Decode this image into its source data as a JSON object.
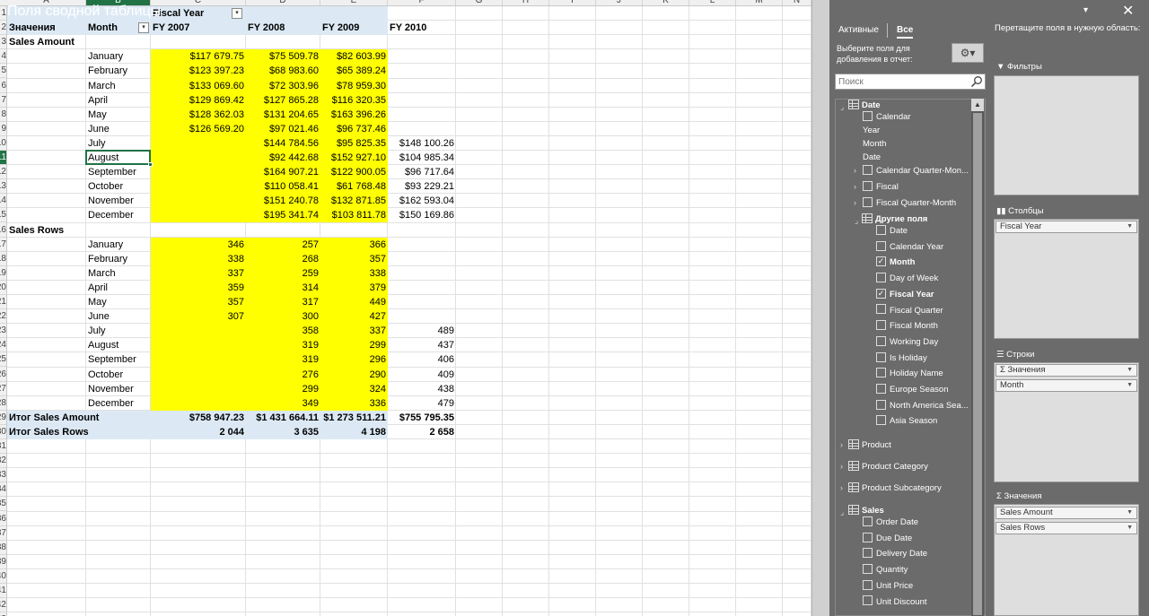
{
  "sheet": {
    "columns": [
      "A",
      "B",
      "C",
      "D",
      "E",
      "F",
      "G",
      "H",
      "I",
      "J",
      "K",
      "L",
      "M",
      "N"
    ],
    "pivot_header": {
      "fiscal_year_label": "Fiscal Year",
      "values_label": "Значения",
      "month_label": "Month",
      "years": [
        "FY 2007",
        "FY 2008",
        "FY 2009",
        "FY 2010"
      ]
    },
    "sales_amount": {
      "label": "Sales Amount",
      "rows": [
        {
          "month": "January",
          "vals": [
            "$117 679.75",
            "$75 509.78",
            "$82 603.99",
            ""
          ]
        },
        {
          "month": "February",
          "vals": [
            "$123 397.23",
            "$68 983.60",
            "$65 389.24",
            ""
          ]
        },
        {
          "month": "March",
          "vals": [
            "$133 069.60",
            "$72 303.96",
            "$78 959.30",
            ""
          ]
        },
        {
          "month": "April",
          "vals": [
            "$129 869.42",
            "$127 865.28",
            "$116 320.35",
            ""
          ]
        },
        {
          "month": "May",
          "vals": [
            "$128 362.03",
            "$131 204.65",
            "$163 396.26",
            ""
          ]
        },
        {
          "month": "June",
          "vals": [
            "$126 569.20",
            "$97 021.46",
            "$96 737.46",
            ""
          ]
        },
        {
          "month": "July",
          "vals": [
            "",
            "$144 784.56",
            "$95 825.35",
            "$148 100.26"
          ]
        },
        {
          "month": "August",
          "vals": [
            "",
            "$92 442.68",
            "$152 927.10",
            "$104 985.34"
          ]
        },
        {
          "month": "September",
          "vals": [
            "",
            "$164 907.21",
            "$122 900.05",
            "$96 717.64"
          ]
        },
        {
          "month": "October",
          "vals": [
            "",
            "$110 058.41",
            "$61 768.48",
            "$93 229.21"
          ]
        },
        {
          "month": "November",
          "vals": [
            "",
            "$151 240.78",
            "$132 871.85",
            "$162 593.04"
          ]
        },
        {
          "month": "December",
          "vals": [
            "",
            "$195 341.74",
            "$103 811.78",
            "$150 169.86"
          ]
        }
      ]
    },
    "sales_rows": {
      "label": "Sales Rows",
      "rows": [
        {
          "month": "January",
          "vals": [
            "346",
            "257",
            "366",
            ""
          ]
        },
        {
          "month": "February",
          "vals": [
            "338",
            "268",
            "357",
            ""
          ]
        },
        {
          "month": "March",
          "vals": [
            "337",
            "259",
            "338",
            ""
          ]
        },
        {
          "month": "April",
          "vals": [
            "359",
            "314",
            "379",
            ""
          ]
        },
        {
          "month": "May",
          "vals": [
            "357",
            "317",
            "449",
            ""
          ]
        },
        {
          "month": "June",
          "vals": [
            "307",
            "300",
            "427",
            ""
          ]
        },
        {
          "month": "July",
          "vals": [
            "",
            "358",
            "337",
            "489"
          ]
        },
        {
          "month": "August",
          "vals": [
            "",
            "319",
            "299",
            "437"
          ]
        },
        {
          "month": "September",
          "vals": [
            "",
            "319",
            "296",
            "406"
          ]
        },
        {
          "month": "October",
          "vals": [
            "",
            "276",
            "290",
            "409"
          ]
        },
        {
          "month": "November",
          "vals": [
            "",
            "299",
            "324",
            "438"
          ]
        },
        {
          "month": "December",
          "vals": [
            "",
            "349",
            "336",
            "479"
          ]
        }
      ]
    },
    "totals": [
      {
        "label": "Итог Sales Amount",
        "vals": [
          "$758 947.23",
          "$1 431 664.11",
          "$1 273 511.21",
          "$755 795.35"
        ]
      },
      {
        "label": "Итог Sales Rows",
        "vals": [
          "2 044",
          "3 635",
          "4 198",
          "2 658"
        ]
      }
    ],
    "highlight_color": "#ffff00",
    "header_band_color": "#dce9f5",
    "active_cell": "August"
  },
  "pivot_panel": {
    "title": "Поля сводной таблицы",
    "tabs": {
      "active": "Активные",
      "all": "Все"
    },
    "choose_fields": "Выберите поля для добавления в отчет:",
    "search_placeholder": "Поиск",
    "drag_hint": "Перетащите поля в нужную область:",
    "fields": {
      "date_table": "Date",
      "date_items": [
        "Calendar",
        "Year",
        "Month",
        "Date",
        "Calendar Quarter-Mon...",
        "Fiscal",
        "Fiscal Quarter-Month"
      ],
      "other_fields": "Другие поля",
      "other_items": [
        {
          "label": "Date",
          "checked": false
        },
        {
          "label": "Calendar Year",
          "checked": false
        },
        {
          "label": "Month",
          "checked": true
        },
        {
          "label": "Day of Week",
          "checked": false
        },
        {
          "label": "Fiscal Year",
          "checked": true
        },
        {
          "label": "Fiscal Quarter",
          "checked": false
        },
        {
          "label": "Fiscal Month",
          "checked": false
        },
        {
          "label": "Working Day",
          "checked": false
        },
        {
          "label": "Is Holiday",
          "checked": false
        },
        {
          "label": "Holiday Name",
          "checked": false
        },
        {
          "label": "Europe Season",
          "checked": false
        },
        {
          "label": "North America Sea...",
          "checked": false
        },
        {
          "label": "Asia Season",
          "checked": false
        }
      ],
      "tables": [
        "Product",
        "Product Category",
        "Product Subcategory"
      ],
      "sales_table": "Sales",
      "sales_items": [
        "Order Date",
        "Due Date",
        "Delivery Date",
        "Quantity",
        "Unit Price",
        "Unit Discount"
      ]
    },
    "areas": {
      "filters": "Фильтры",
      "columns": "Столбцы",
      "rows": "Строки",
      "values": "Значения",
      "columns_items": [
        "Fiscal Year"
      ],
      "rows_items": [
        "Σ Значения",
        "Month"
      ],
      "values_items": [
        "Sales Amount",
        "Sales Rows"
      ]
    }
  }
}
